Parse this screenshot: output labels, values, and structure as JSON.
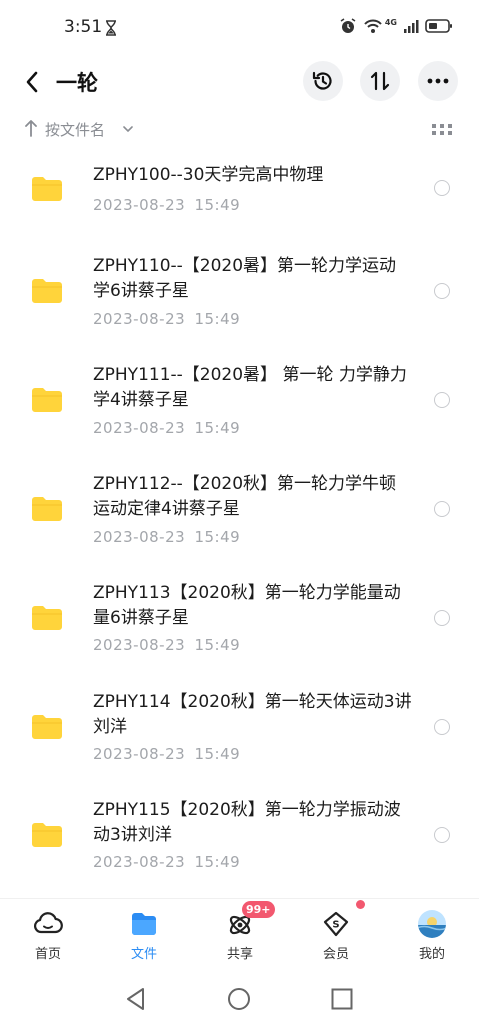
{
  "status_bar": {
    "time": "3:51",
    "network_label": "4G",
    "icons": [
      "hourglass-icon",
      "alarm-icon",
      "wifi-icon",
      "signal-icon",
      "battery-icon"
    ]
  },
  "header": {
    "title": "一轮",
    "actions": [
      "history-icon",
      "sort-toggle-icon",
      "more-icon"
    ]
  },
  "sort": {
    "label": "按文件名"
  },
  "files": [
    {
      "name": "ZPHY100--30天学完高中物理",
      "date": "2023-08-23  15:49"
    },
    {
      "name": "ZPHY110--【2020暑】第一轮力学运动学6讲蔡子星",
      "date": "2023-08-23  15:49"
    },
    {
      "name": "ZPHY111--【2020暑】 第一轮 力学静力学4讲蔡子星",
      "date": "2023-08-23  15:49"
    },
    {
      "name": "ZPHY112--【2020秋】第一轮力学牛顿运动定律4讲蔡子星",
      "date": "2023-08-23  15:49"
    },
    {
      "name": "ZPHY113【2020秋】第一轮力学能量动量6讲蔡子星",
      "date": "2023-08-23  15:49"
    },
    {
      "name": "ZPHY114【2020秋】第一轮天体运动3讲刘洋",
      "date": "2023-08-23  15:49"
    },
    {
      "name": "ZPHY115【2020秋】第一轮力学振动波动3讲刘洋",
      "date": "2023-08-23  15:49"
    }
  ],
  "bottom_nav": {
    "items": [
      {
        "label": "首页",
        "icon": "home-cloud-icon"
      },
      {
        "label": "文件",
        "icon": "folder-icon",
        "active": true
      },
      {
        "label": "共享",
        "icon": "share-icon",
        "badge": "99+"
      },
      {
        "label": "会员",
        "icon": "vip-icon",
        "dot": true
      },
      {
        "label": "我的",
        "icon": "avatar"
      }
    ]
  },
  "colors": {
    "accent": "#2b8cf3",
    "folder": "#ffd43b",
    "badge": "#f2586f"
  }
}
